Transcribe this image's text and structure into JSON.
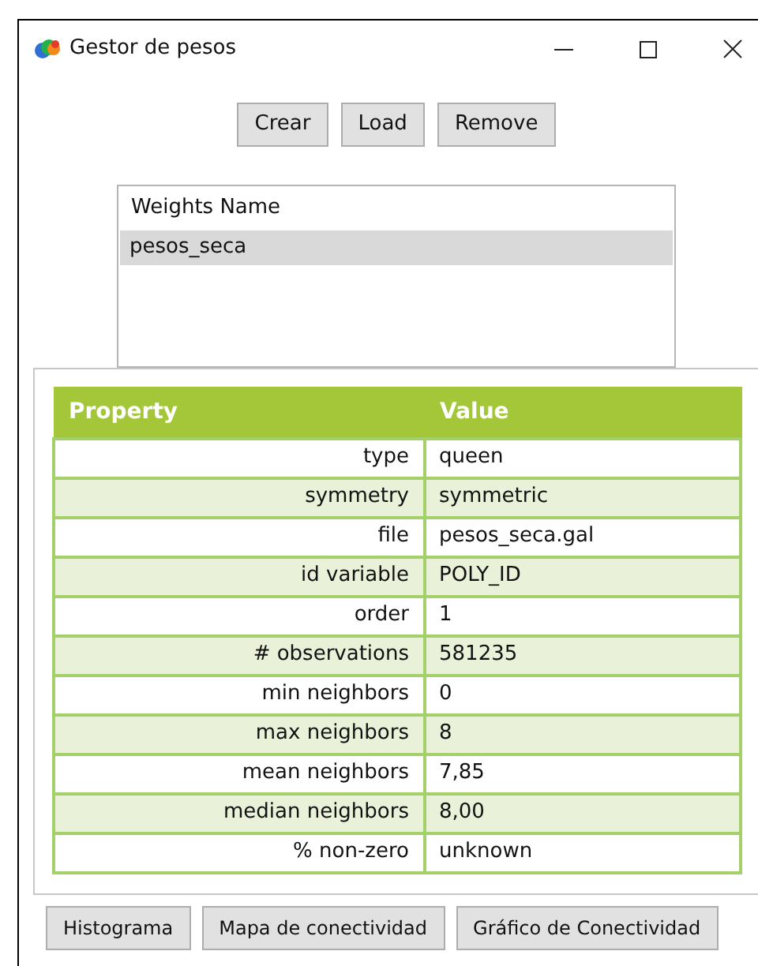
{
  "window": {
    "title": "Gestor de pesos"
  },
  "top_buttons": [
    "Crear",
    "Load",
    "Remove"
  ],
  "weights_list": {
    "header": "Weights Name",
    "items": [
      {
        "label": "pesos_seca",
        "selected": true
      }
    ]
  },
  "table": {
    "columns": [
      "Property",
      "Value"
    ],
    "rows": [
      {
        "property": "type",
        "value": "queen"
      },
      {
        "property": "symmetry",
        "value": "symmetric"
      },
      {
        "property": "file",
        "value": "pesos_seca.gal"
      },
      {
        "property": "id variable",
        "value": "POLY_ID"
      },
      {
        "property": "order",
        "value": "1"
      },
      {
        "property": "# observations",
        "value": "581235"
      },
      {
        "property": "min neighbors",
        "value": "0"
      },
      {
        "property": "max neighbors",
        "value": "8"
      },
      {
        "property": "mean neighbors",
        "value": "7,85"
      },
      {
        "property": "median neighbors",
        "value": "8,00"
      },
      {
        "property": "% non-zero",
        "value": "unknown"
      }
    ]
  },
  "bottom_buttons": [
    "Histograma",
    "Mapa de conectividad",
    "Gráfico de Conectividad"
  ]
}
